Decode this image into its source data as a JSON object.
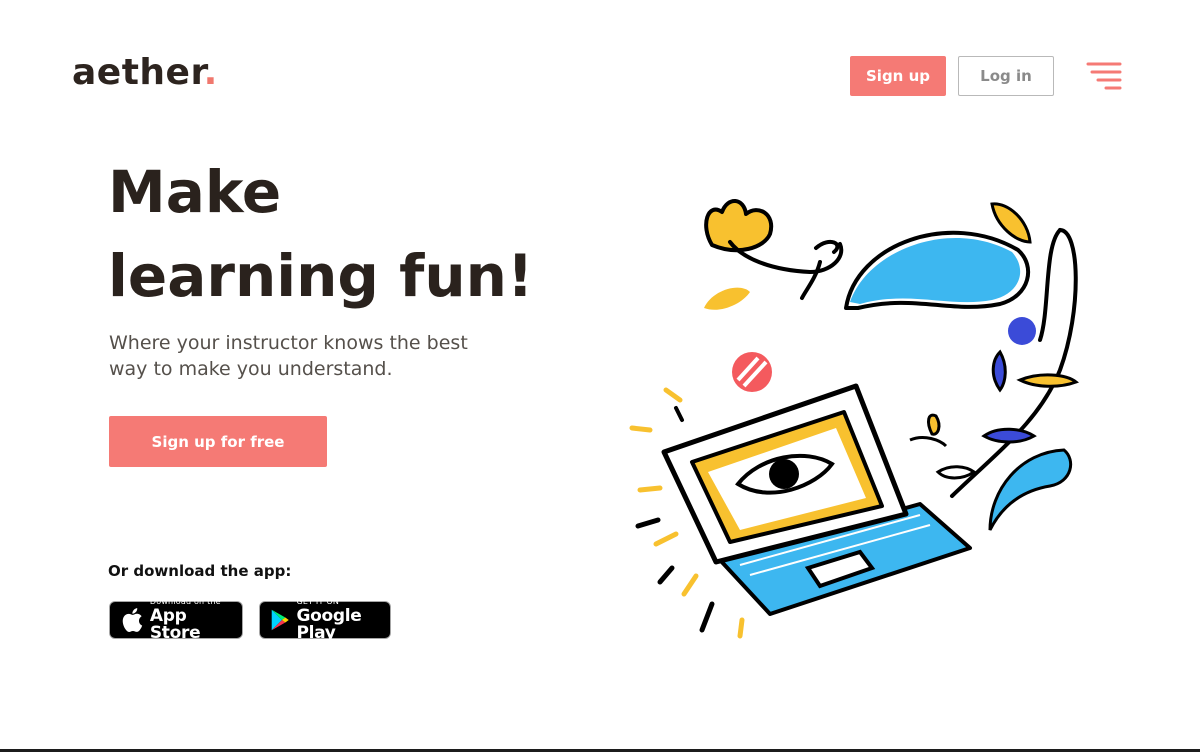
{
  "brand": {
    "name": "aether",
    "dot": ".",
    "accent_color": "#f57a75"
  },
  "nav": {
    "signup_label": "Sign up",
    "login_label": "Log in",
    "menu_icon": "hamburger-menu-icon"
  },
  "hero": {
    "title_line1": "Make",
    "title_line2": "learning fun!",
    "subtitle": "Where your instructor knows the best way to make you understand.",
    "cta_label": "Sign up for free"
  },
  "download": {
    "label": "Or download the app:",
    "app_store": {
      "small": "Download on the",
      "big": "App Store",
      "icon": "apple-icon"
    },
    "google_play": {
      "small": "GET IT ON",
      "big": "Google Play",
      "icon": "google-play-icon"
    }
  },
  "illustration": {
    "icon": "laptop-with-eye-and-plants-illustration",
    "colors": {
      "yellow": "#f8c12f",
      "blue": "#3db7f0",
      "navy": "#3b4bd8",
      "red": "#f45a5e",
      "outline": "#000000"
    }
  }
}
